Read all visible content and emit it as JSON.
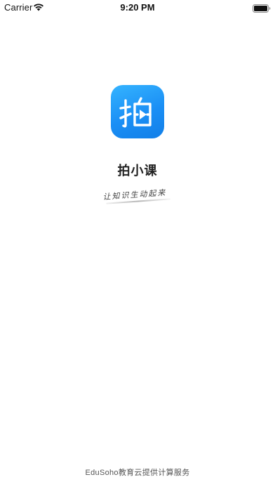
{
  "status_bar": {
    "carrier": "Carrier",
    "time": "9:20 PM",
    "wifi_icon": "wifi-icon",
    "battery_icon": "battery-icon"
  },
  "app": {
    "logo_icon": "app-logo-icon",
    "logo_glyph": "拍",
    "name": "拍小课",
    "slogan": "让知识生动起来",
    "brand_color": "#1b8ff5"
  },
  "footer": {
    "text": "EduSoho教育云提供计算服务"
  }
}
